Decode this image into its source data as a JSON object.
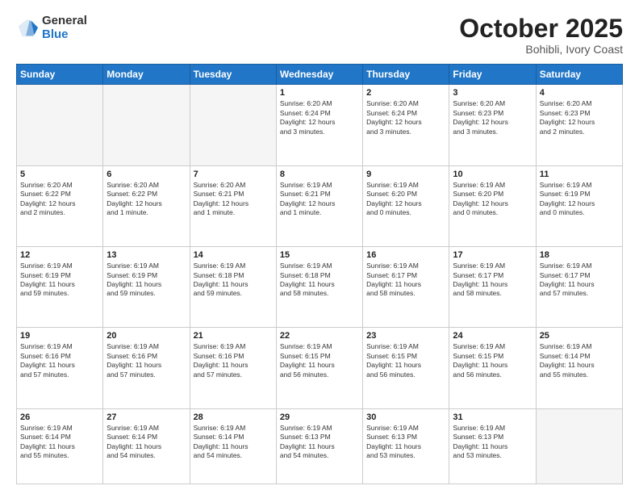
{
  "header": {
    "logo_general": "General",
    "logo_blue": "Blue",
    "month_title": "October 2025",
    "location": "Bohibli, Ivory Coast"
  },
  "days_of_week": [
    "Sunday",
    "Monday",
    "Tuesday",
    "Wednesday",
    "Thursday",
    "Friday",
    "Saturday"
  ],
  "weeks": [
    [
      {
        "day": "",
        "info": ""
      },
      {
        "day": "",
        "info": ""
      },
      {
        "day": "",
        "info": ""
      },
      {
        "day": "1",
        "info": "Sunrise: 6:20 AM\nSunset: 6:24 PM\nDaylight: 12 hours\nand 3 minutes."
      },
      {
        "day": "2",
        "info": "Sunrise: 6:20 AM\nSunset: 6:24 PM\nDaylight: 12 hours\nand 3 minutes."
      },
      {
        "day": "3",
        "info": "Sunrise: 6:20 AM\nSunset: 6:23 PM\nDaylight: 12 hours\nand 3 minutes."
      },
      {
        "day": "4",
        "info": "Sunrise: 6:20 AM\nSunset: 6:23 PM\nDaylight: 12 hours\nand 2 minutes."
      }
    ],
    [
      {
        "day": "5",
        "info": "Sunrise: 6:20 AM\nSunset: 6:22 PM\nDaylight: 12 hours\nand 2 minutes."
      },
      {
        "day": "6",
        "info": "Sunrise: 6:20 AM\nSunset: 6:22 PM\nDaylight: 12 hours\nand 1 minute."
      },
      {
        "day": "7",
        "info": "Sunrise: 6:20 AM\nSunset: 6:21 PM\nDaylight: 12 hours\nand 1 minute."
      },
      {
        "day": "8",
        "info": "Sunrise: 6:19 AM\nSunset: 6:21 PM\nDaylight: 12 hours\nand 1 minute."
      },
      {
        "day": "9",
        "info": "Sunrise: 6:19 AM\nSunset: 6:20 PM\nDaylight: 12 hours\nand 0 minutes."
      },
      {
        "day": "10",
        "info": "Sunrise: 6:19 AM\nSunset: 6:20 PM\nDaylight: 12 hours\nand 0 minutes."
      },
      {
        "day": "11",
        "info": "Sunrise: 6:19 AM\nSunset: 6:19 PM\nDaylight: 12 hours\nand 0 minutes."
      }
    ],
    [
      {
        "day": "12",
        "info": "Sunrise: 6:19 AM\nSunset: 6:19 PM\nDaylight: 11 hours\nand 59 minutes."
      },
      {
        "day": "13",
        "info": "Sunrise: 6:19 AM\nSunset: 6:19 PM\nDaylight: 11 hours\nand 59 minutes."
      },
      {
        "day": "14",
        "info": "Sunrise: 6:19 AM\nSunset: 6:18 PM\nDaylight: 11 hours\nand 59 minutes."
      },
      {
        "day": "15",
        "info": "Sunrise: 6:19 AM\nSunset: 6:18 PM\nDaylight: 11 hours\nand 58 minutes."
      },
      {
        "day": "16",
        "info": "Sunrise: 6:19 AM\nSunset: 6:17 PM\nDaylight: 11 hours\nand 58 minutes."
      },
      {
        "day": "17",
        "info": "Sunrise: 6:19 AM\nSunset: 6:17 PM\nDaylight: 11 hours\nand 58 minutes."
      },
      {
        "day": "18",
        "info": "Sunrise: 6:19 AM\nSunset: 6:17 PM\nDaylight: 11 hours\nand 57 minutes."
      }
    ],
    [
      {
        "day": "19",
        "info": "Sunrise: 6:19 AM\nSunset: 6:16 PM\nDaylight: 11 hours\nand 57 minutes."
      },
      {
        "day": "20",
        "info": "Sunrise: 6:19 AM\nSunset: 6:16 PM\nDaylight: 11 hours\nand 57 minutes."
      },
      {
        "day": "21",
        "info": "Sunrise: 6:19 AM\nSunset: 6:16 PM\nDaylight: 11 hours\nand 57 minutes."
      },
      {
        "day": "22",
        "info": "Sunrise: 6:19 AM\nSunset: 6:15 PM\nDaylight: 11 hours\nand 56 minutes."
      },
      {
        "day": "23",
        "info": "Sunrise: 6:19 AM\nSunset: 6:15 PM\nDaylight: 11 hours\nand 56 minutes."
      },
      {
        "day": "24",
        "info": "Sunrise: 6:19 AM\nSunset: 6:15 PM\nDaylight: 11 hours\nand 56 minutes."
      },
      {
        "day": "25",
        "info": "Sunrise: 6:19 AM\nSunset: 6:14 PM\nDaylight: 11 hours\nand 55 minutes."
      }
    ],
    [
      {
        "day": "26",
        "info": "Sunrise: 6:19 AM\nSunset: 6:14 PM\nDaylight: 11 hours\nand 55 minutes."
      },
      {
        "day": "27",
        "info": "Sunrise: 6:19 AM\nSunset: 6:14 PM\nDaylight: 11 hours\nand 54 minutes."
      },
      {
        "day": "28",
        "info": "Sunrise: 6:19 AM\nSunset: 6:14 PM\nDaylight: 11 hours\nand 54 minutes."
      },
      {
        "day": "29",
        "info": "Sunrise: 6:19 AM\nSunset: 6:13 PM\nDaylight: 11 hours\nand 54 minutes."
      },
      {
        "day": "30",
        "info": "Sunrise: 6:19 AM\nSunset: 6:13 PM\nDaylight: 11 hours\nand 53 minutes."
      },
      {
        "day": "31",
        "info": "Sunrise: 6:19 AM\nSunset: 6:13 PM\nDaylight: 11 hours\nand 53 minutes."
      },
      {
        "day": "",
        "info": ""
      }
    ]
  ]
}
